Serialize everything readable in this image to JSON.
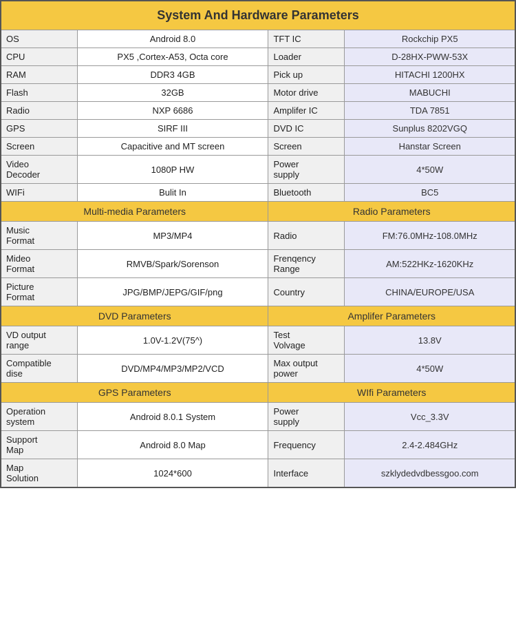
{
  "title": "System And Hardware Parameters",
  "sections": {
    "system": {
      "rows": [
        {
          "left_label": "OS",
          "left_value": "Android 8.0",
          "right_label": "TFT IC",
          "right_value": "Rockchip PX5"
        },
        {
          "left_label": "CPU",
          "left_value": "PX5 ,Cortex-A53, Octa core",
          "right_label": "Loader",
          "right_value": "D-28HX-PWW-53X"
        },
        {
          "left_label": "RAM",
          "left_value": "DDR3 4GB",
          "right_label": "Pick up",
          "right_value": "HITACHI 1200HX"
        },
        {
          "left_label": "Flash",
          "left_value": "32GB",
          "right_label": "Motor drive",
          "right_value": "MABUCHI"
        },
        {
          "left_label": "Radio",
          "left_value": "NXP 6686",
          "right_label": "Amplifer IC",
          "right_value": "TDA 7851"
        },
        {
          "left_label": "GPS",
          "left_value": "SIRF III",
          "right_label": "DVD IC",
          "right_value": "Sunplus 8202VGQ"
        },
        {
          "left_label": "Screen",
          "left_value": "Capacitive and MT screen",
          "right_label": "Screen",
          "right_value": "Hanstar Screen"
        },
        {
          "left_label": "Video\nDecoder",
          "left_value": "1080P HW",
          "right_label": "Power\nsupply",
          "right_value": "4*50W"
        },
        {
          "left_label": "WIFi",
          "left_value": "Bulit In",
          "right_label": "Bluetooth",
          "right_value": "BC5"
        }
      ]
    },
    "multimedia_header": "Multi-media Parameters",
    "radio_header": "Radio Parameters",
    "multimedia": {
      "rows": [
        {
          "left_label": "Music\nFormat",
          "left_value": "MP3/MP4",
          "right_label": "Radio",
          "right_value": "FM:76.0MHz-108.0MHz"
        },
        {
          "left_label": "Mideo\nFormat",
          "left_value": "RMVB/Spark/Sorenson",
          "right_label": "Frenqency\nRange",
          "right_value": "AM:522HKz-1620KHz"
        },
        {
          "left_label": "Picture\nFormat",
          "left_value": "JPG/BMP/JEPG/GIF/png",
          "right_label": "Country",
          "right_value": "CHINA/EUROPE/USA"
        }
      ]
    },
    "dvd_header": "DVD Parameters",
    "amplifier_header": "Amplifer Parameters",
    "dvd": {
      "rows": [
        {
          "left_label": "VD output\nrange",
          "left_value": "1.0V-1.2V(75^)",
          "right_label": "Test\nVolvage",
          "right_value": "13.8V"
        },
        {
          "left_label": "Compatible\ndise",
          "left_value": "DVD/MP4/MP3/MP2/VCD",
          "right_label": "Max output\npower",
          "right_value": "4*50W"
        }
      ]
    },
    "gps_header": "GPS Parameters",
    "wifi_header": "WIfi Parameters",
    "gps": {
      "rows": [
        {
          "left_label": "Operation\nsystem",
          "left_value": "Android 8.0.1 System",
          "right_label": "Power\nsupply",
          "right_value": "Vcc_3.3V"
        },
        {
          "left_label": "Support\nMap",
          "left_value": "Android 8.0 Map",
          "right_label": "Frequency",
          "right_value": "2.4-2.484GHz"
        },
        {
          "left_label": "Map\nSolution",
          "left_value": "1024*600",
          "right_label": "Interface",
          "right_value": "szklydedvdbessgoo.com"
        }
      ]
    }
  }
}
